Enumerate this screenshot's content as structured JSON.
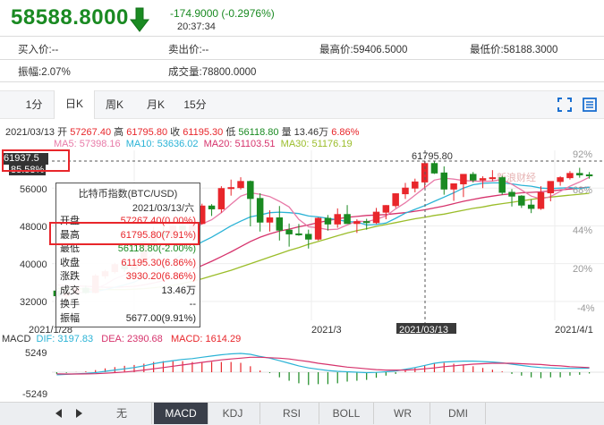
{
  "header": {
    "price": "58588.8000",
    "change": "-174.9000 (-0.2976%)",
    "time": "20:37:34"
  },
  "stats": {
    "bid": "买入价:--",
    "ask": "卖出价:--",
    "high": "最高价:59406.5000",
    "low": "最低价:58188.3000",
    "amplitude": "振幅:2.07%",
    "volume": "成交量:78800.0000"
  },
  "period_tabs": [
    "1分",
    "日K",
    "周K",
    "月K",
    "15分"
  ],
  "active_period": "日K",
  "info_bar": {
    "date": "2021/03/13",
    "open_label": "开",
    "open": "57267.40",
    "high_label": "高",
    "high": "61795.80",
    "close_label": "收",
    "close": "61195.30",
    "low_label": "低",
    "low": "56118.80",
    "vol_label": "量",
    "vol": "13.46万",
    "pct": "6.86%"
  },
  "ma_legend": {
    "ma5": "MA5: 57398.16",
    "ma10": "MA10: 53636.02",
    "ma20": "MA20: 51103.51",
    "ma30": "MA30: 51176.19"
  },
  "colors": {
    "up": "#e8262b",
    "down": "#1a8a22",
    "ma5": "#e87aa8",
    "ma10": "#2bb3d6",
    "ma20": "#d6336c",
    "ma30": "#9bbd2a",
    "accent": "#1a6fd0"
  },
  "left_axis": [
    "56000",
    "48000",
    "40000",
    "32000"
  ],
  "right_axis": [
    "92%",
    "68%",
    "44%",
    "20%",
    "-4%"
  ],
  "crosshair_price": "61937.5",
  "crosshair_pct": "85.58%",
  "peak_label": "61795.80",
  "x_labels": {
    "start": "2021/1/28",
    "mid": "2021/3",
    "hover": "2021/03/13",
    "end": "2021/4/1"
  },
  "watermark": "新浪财经",
  "tooltip": {
    "title": "比特币指数(BTC/USD)",
    "date": "2021/03/13/六",
    "rows": [
      {
        "k": "开盘",
        "v": "57267.40(0.00%)",
        "c": "up"
      },
      {
        "k": "最高",
        "v": "61795.80(7.91%)",
        "c": "up"
      },
      {
        "k": "最低",
        "v": "56118.80(-2.00%)",
        "c": "down"
      },
      {
        "k": "收盘",
        "v": "61195.30(6.86%)",
        "c": "up"
      },
      {
        "k": "涨跌",
        "v": "3930.20(6.86%)",
        "c": "up"
      },
      {
        "k": "成交",
        "v": "13.46万",
        "c": "plain"
      },
      {
        "k": "换手",
        "v": "--",
        "c": "plain"
      },
      {
        "k": "振幅",
        "v": "5677.00(9.91%)",
        "c": "plain"
      }
    ]
  },
  "macd_legend": {
    "name": "MACD",
    "dif": "DIF: 3197.83",
    "dea": "DEA: 2390.68",
    "macd": "MACD: 1614.29"
  },
  "macd_axis": [
    "5249",
    "-5249"
  ],
  "indicator_tabs": [
    "无",
    "MACD",
    "KDJ",
    "RSI",
    "BOLL",
    "WR",
    "DMI"
  ],
  "active_indicator": "MACD",
  "chart_data": {
    "type": "candlestick",
    "title": "比特币指数(BTC/USD)",
    "ylim": [
      28000,
      64000
    ],
    "candles": [
      [
        34200,
        34600,
        32300,
        33200
      ],
      [
        33200,
        34100,
        32200,
        33800
      ],
      [
        33800,
        35200,
        33400,
        34800
      ],
      [
        34800,
        35400,
        33600,
        33900
      ],
      [
        33900,
        37800,
        33700,
        37400
      ],
      [
        37400,
        38700,
        36800,
        38300
      ],
      [
        38300,
        40200,
        37900,
        39800
      ],
      [
        39800,
        40900,
        38200,
        38900
      ],
      [
        38900,
        40700,
        38600,
        40300
      ],
      [
        40300,
        44800,
        40000,
        44600
      ],
      [
        44600,
        47800,
        44300,
        46700
      ],
      [
        46700,
        48100,
        45200,
        45900
      ],
      [
        45900,
        48600,
        45400,
        48000
      ],
      [
        48000,
        48800,
        46900,
        47200
      ],
      [
        47200,
        49000,
        46300,
        48500
      ],
      [
        48500,
        52700,
        48300,
        52200
      ],
      [
        52200,
        52600,
        50100,
        51600
      ],
      [
        51600,
        56400,
        50800,
        55900
      ],
      [
        55900,
        57800,
        54400,
        56100
      ],
      [
        56100,
        58300,
        55700,
        57400
      ],
      [
        57400,
        57600,
        47900,
        53800
      ],
      [
        53800,
        54900,
        46800,
        48800
      ],
      [
        48800,
        51300,
        46800,
        49700
      ],
      [
        49700,
        52200,
        44900,
        47100
      ],
      [
        47100,
        48500,
        43600,
        46300
      ],
      [
        46300,
        48400,
        45900,
        46200
      ],
      [
        46200,
        47200,
        43200,
        45200
      ],
      [
        45200,
        49800,
        44900,
        49600
      ],
      [
        49600,
        50300,
        47000,
        48400
      ],
      [
        48400,
        51700,
        47600,
        50400
      ],
      [
        50400,
        52400,
        48800,
        48500
      ],
      [
        48500,
        49400,
        46500,
        48900
      ],
      [
        48900,
        49500,
        47200,
        48700
      ],
      [
        48700,
        51800,
        48400,
        50900
      ],
      [
        50900,
        52400,
        49400,
        52300
      ],
      [
        52300,
        54900,
        51800,
        54800
      ],
      [
        54800,
        57100,
        53700,
        56000
      ],
      [
        56000,
        58000,
        55100,
        57300
      ],
      [
        57300,
        61800,
        56100,
        61200
      ],
      [
        61200,
        61700,
        59000,
        59200
      ],
      [
        59200,
        60600,
        54600,
        55800
      ],
      [
        55800,
        56700,
        53300,
        56900
      ],
      [
        56900,
        58900,
        54100,
        58900
      ],
      [
        58900,
        59400,
        57200,
        57700
      ],
      [
        57700,
        58500,
        56000,
        58000
      ],
      [
        58000,
        59800,
        57500,
        58200
      ],
      [
        58200,
        58600,
        54600,
        55100
      ],
      [
        55100,
        55800,
        52100,
        54300
      ],
      [
        54300,
        54500,
        51800,
        52400
      ],
      [
        52400,
        53600,
        50700,
        51700
      ],
      [
        51700,
        56400,
        51400,
        55000
      ],
      [
        55000,
        57400,
        53200,
        57400
      ],
      [
        57400,
        58500,
        56500,
        58200
      ],
      [
        58200,
        59600,
        57800,
        59100
      ],
      [
        59100,
        60300,
        58200,
        58800
      ],
      [
        58800,
        59400,
        58000,
        58600
      ]
    ],
    "ma5": [
      33000,
      33400,
      33700,
      34000,
      34600,
      35600,
      36800,
      37600,
      38900,
      40300,
      42100,
      43200,
      44900,
      46200,
      47300,
      48400,
      49300,
      50800,
      52600,
      54300,
      55000,
      54700,
      54200,
      53200,
      52000,
      49400,
      47800,
      47600,
      47200,
      47300,
      48200,
      49000,
      48900,
      49400,
      50100,
      51600,
      52900,
      54500,
      56100,
      57700,
      58100,
      57900,
      57600,
      57500,
      57400,
      57500,
      57800,
      56800,
      55600,
      54300,
      53700,
      54200,
      55300,
      56400,
      57300,
      58300
    ],
    "ma10": [
      33500,
      33600,
      33800,
      33900,
      34100,
      34500,
      35000,
      35500,
      36100,
      37100,
      38100,
      39200,
      40600,
      42100,
      43200,
      44600,
      45600,
      46800,
      48000,
      49000,
      49900,
      50300,
      50800,
      50900,
      50800,
      50600,
      50100,
      49900,
      49600,
      49300,
      48900,
      48800,
      48200,
      48300,
      48600,
      49600,
      50700,
      51500,
      52300,
      53200,
      54100,
      55000,
      56000,
      56700,
      57000,
      57100,
      57100,
      56900,
      56600,
      56400,
      56000,
      55900,
      56000,
      56100,
      55900,
      56200
    ],
    "ma20": [
      35500,
      35400,
      35300,
      35200,
      35100,
      35000,
      35000,
      35100,
      35200,
      35500,
      35900,
      36400,
      37100,
      37900,
      38700,
      39600,
      40500,
      41500,
      42500,
      43600,
      44700,
      45600,
      46300,
      46900,
      47300,
      47800,
      48200,
      48700,
      49100,
      49500,
      49800,
      50000,
      50200,
      50300,
      50400,
      50600,
      50800,
      51100,
      51400,
      51800,
      52200,
      52700,
      53200,
      53600,
      54000,
      54300,
      54600,
      54800,
      55000,
      55100,
      55200,
      55400,
      55600,
      55800,
      56000,
      56200
    ],
    "ma30": [
      34800,
      34700,
      34700,
      34600,
      34600,
      34500,
      34500,
      34500,
      34600,
      34700,
      34900,
      35100,
      35400,
      35800,
      36300,
      36800,
      37400,
      38000,
      38600,
      39300,
      40000,
      40700,
      41400,
      42100,
      42800,
      43400,
      44100,
      44700,
      45300,
      45900,
      46500,
      47000,
      47400,
      47900,
      48300,
      48700,
      49100,
      49500,
      49800,
      50200,
      50500,
      50900,
      51300,
      51700,
      52000,
      52400,
      52700,
      53000,
      53300,
      53600,
      53900,
      54100,
      54300,
      54500,
      54700,
      54900
    ],
    "macd_ylim": [
      -5249,
      5249
    ],
    "dif": [
      -600,
      -500,
      -400,
      -300,
      -100,
      200,
      500,
      800,
      1100,
      1500,
      2000,
      2400,
      2700,
      3000,
      3200,
      3500,
      3800,
      4100,
      4300,
      4400,
      4200,
      3700,
      3300,
      2700,
      2100,
      1500,
      1000,
      700,
      400,
      200,
      100,
      0,
      -100,
      -50,
      100,
      300,
      700,
      1100,
      1600,
      2100,
      2400,
      2500,
      2600,
      2600,
      2500,
      2400,
      2200,
      1900,
      1600,
      1300,
      1100,
      1000,
      900,
      900,
      900,
      950
    ],
    "dea": [
      -400,
      -420,
      -420,
      -400,
      -350,
      -250,
      -100,
      50,
      250,
      500,
      800,
      1100,
      1400,
      1700,
      2000,
      2300,
      2600,
      2900,
      3100,
      3300,
      3500,
      3500,
      3400,
      3300,
      3100,
      2800,
      2500,
      2100,
      1800,
      1500,
      1200,
      1000,
      800,
      600,
      500,
      500,
      500,
      600,
      800,
      1000,
      1300,
      1500,
      1700,
      1900,
      2000,
      2100,
      2100,
      2100,
      2000,
      1900,
      1800,
      1600,
      1500,
      1300,
      1200,
      1100
    ],
    "macd": [
      -400,
      -160,
      40,
      200,
      500,
      900,
      1200,
      1500,
      1700,
      2000,
      2400,
      2600,
      2600,
      2600,
      2400,
      2400,
      2400,
      2400,
      2400,
      2200,
      1400,
      400,
      -200,
      -1200,
      -2000,
      -2600,
      -3000,
      -2800,
      -2800,
      -2600,
      -2200,
      -2000,
      -1800,
      -1300,
      -800,
      -400,
      400,
      1000,
      1600,
      2200,
      2200,
      2000,
      1800,
      1400,
      1000,
      600,
      200,
      -400,
      -800,
      -1200,
      -1400,
      -1200,
      -1200,
      -800,
      -600,
      -300
    ]
  }
}
